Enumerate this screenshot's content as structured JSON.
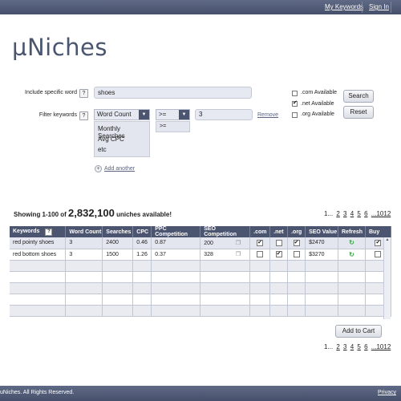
{
  "topbar": {
    "my_keywords": "My Keywords",
    "sign_in": "Sign In"
  },
  "logo": "µNiches",
  "form": {
    "include_label": "Include specific word",
    "help": "?",
    "include_value": "shoes",
    "filter_label": "Filter keywords",
    "filter_field": "Word Count",
    "operator": ">=",
    "operator_options": [
      ">="
    ],
    "filter_value": "3",
    "remove": "Remove",
    "field_options": [
      "Monthly Searches",
      "Avg CPC",
      "etc"
    ],
    "add_another": "Add another",
    "plus": "+"
  },
  "domains": {
    "com": {
      "label": ".com Available",
      "checked": false
    },
    "net": {
      "label": ".net Available",
      "checked": true
    },
    "org": {
      "label": ".org Available",
      "checked": false
    }
  },
  "buttons": {
    "search": "Search",
    "reset": "Reset",
    "add_to_cart": "Add to Cart"
  },
  "results": {
    "prefix": "Showing 1-100 of ",
    "count": "2,832,100",
    "suffix": " uniches available!"
  },
  "pager": {
    "ellipsis_start": "1...",
    "pages": [
      "2",
      "3",
      "4",
      "5",
      "6"
    ],
    "ellipsis_end": "...1012"
  },
  "table": {
    "columns": [
      "Keywords",
      "Word Count",
      "Searches",
      "CPC",
      "PPC Competition",
      "SEO Competition",
      ".com",
      ".net",
      ".org",
      "SEO Value",
      "Refresh",
      "Buy"
    ],
    "rows": [
      {
        "keyword": "red pointy shoes",
        "word_count": "3",
        "searches": "2400",
        "cpc": "0.46",
        "ppc": "0.87",
        "seo": "200",
        "com": true,
        "net": false,
        "org": true,
        "seo_value": "$2470",
        "buy": true
      },
      {
        "keyword": "red bottom shoes",
        "word_count": "3",
        "searches": "1500",
        "cpc": "1.26",
        "ppc": "0.37",
        "seo": "328",
        "com": false,
        "net": true,
        "org": false,
        "seo_value": "$3270",
        "buy": false
      }
    ],
    "empty_rows": 5
  },
  "footer": {
    "copyright": "uNiches. All Rights Reserved.",
    "privacy": "Privacy"
  },
  "icons": {
    "refresh": "refresh-icon",
    "copy": "copy-icon",
    "dropdown": "chevron-down-icon"
  },
  "colors": {
    "bar": "#4c5570",
    "accent_refresh": "#3ea84b"
  }
}
